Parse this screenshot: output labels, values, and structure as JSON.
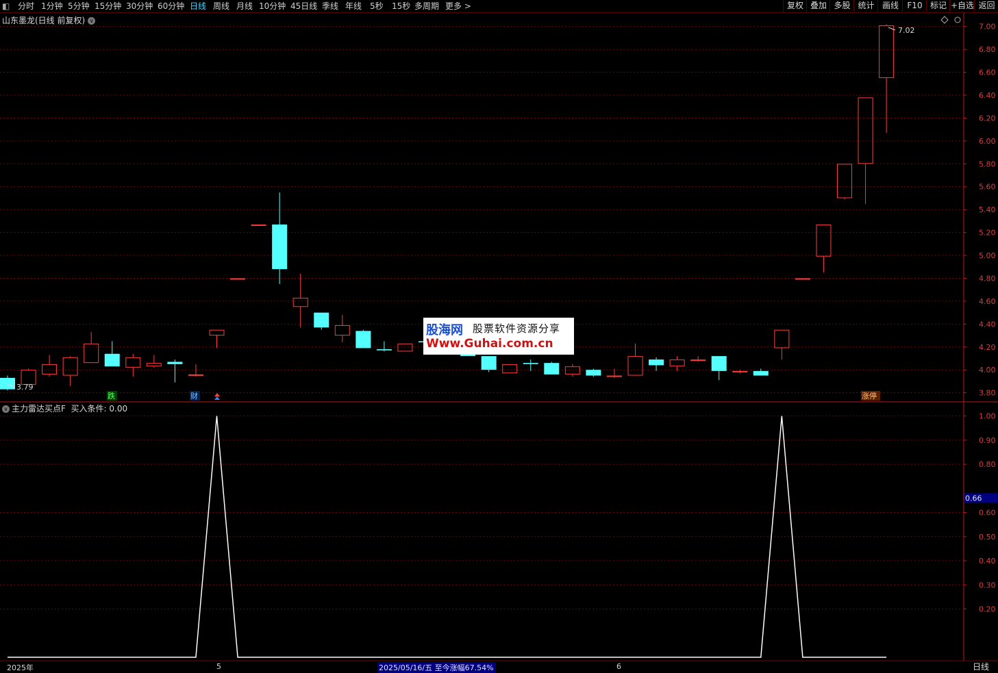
{
  "toolbar": {
    "periods": [
      "分时",
      "1分钟",
      "5分钟",
      "15分钟",
      "30分钟",
      "60分钟",
      "日线",
      "周线",
      "月线",
      "10分钟",
      "45日线",
      "季线",
      "年线",
      "5秒",
      "15秒",
      "多周期",
      "更多 >"
    ],
    "active_period": "日线",
    "right_buttons": [
      "复权",
      "叠加",
      "多股",
      "统计",
      "画线",
      "F10",
      "标记",
      "+自选",
      "返回"
    ]
  },
  "main_chart": {
    "title": "山东墨龙(日线 前复权)",
    "high_label": "7.02",
    "low_label": "3.79",
    "markers": [
      "跌",
      "财",
      "涨停"
    ],
    "y_ticks": [
      "7.00",
      "6.80",
      "6.60",
      "6.40",
      "6.20",
      "6.00",
      "5.80",
      "5.60",
      "5.40",
      "5.20",
      "5.00",
      "4.80",
      "4.60",
      "4.40",
      "4.20",
      "4.00",
      "3.80"
    ],
    "colors": {
      "up": "#ff3c3c",
      "down": "#54ffff",
      "grid": "#7a0000",
      "axis": "#c01818"
    }
  },
  "chart_data": [
    {
      "type": "candlestick",
      "title": "山东墨龙(日线 前复权)",
      "ylim": [
        3.72,
        7.1
      ],
      "candles": [
        {
          "o": 3.93,
          "h": 3.95,
          "l": 3.82,
          "c": 3.83
        },
        {
          "o": 3.87,
          "h": 4.01,
          "l": 3.87,
          "c": 4.0
        },
        {
          "o": 3.96,
          "h": 4.13,
          "l": 3.94,
          "c": 4.05
        },
        {
          "o": 3.95,
          "h": 4.12,
          "l": 3.86,
          "c": 4.11
        },
        {
          "o": 4.06,
          "h": 4.33,
          "l": 4.06,
          "c": 4.23
        },
        {
          "o": 4.14,
          "h": 4.25,
          "l": 4.03,
          "c": 4.03
        },
        {
          "o": 4.02,
          "h": 4.14,
          "l": 3.94,
          "c": 4.11
        },
        {
          "o": 4.03,
          "h": 4.13,
          "l": 4.02,
          "c": 4.06
        },
        {
          "o": 4.07,
          "h": 4.09,
          "l": 3.89,
          "c": 4.05
        },
        {
          "o": 3.96,
          "h": 4.05,
          "l": 3.94,
          "c": 3.96
        },
        {
          "o": 4.3,
          "h": 4.35,
          "l": 4.19,
          "c": 4.35
        },
        {
          "o": 4.8,
          "h": 4.8,
          "l": 4.8,
          "c": 4.8
        },
        {
          "o": 5.27,
          "h": 5.27,
          "l": 5.27,
          "c": 5.27
        },
        {
          "o": 5.27,
          "h": 5.55,
          "l": 4.75,
          "c": 4.88
        },
        {
          "o": 4.55,
          "h": 4.84,
          "l": 4.37,
          "c": 4.63
        },
        {
          "o": 4.5,
          "h": 4.5,
          "l": 4.35,
          "c": 4.37
        },
        {
          "o": 4.3,
          "h": 4.48,
          "l": 4.24,
          "c": 4.39
        },
        {
          "o": 4.34,
          "h": 4.35,
          "l": 4.2,
          "c": 4.19
        },
        {
          "o": 4.18,
          "h": 4.25,
          "l": 4.16,
          "c": 4.17
        },
        {
          "o": 4.16,
          "h": 4.23,
          "l": 4.16,
          "c": 4.23
        },
        {
          "o": 4.25,
          "h": 4.27,
          "l": 4.2,
          "c": 4.24
        },
        {
          "o": 4.27,
          "h": 4.3,
          "l": 4.22,
          "c": 4.24
        },
        {
          "o": 4.25,
          "h": 4.28,
          "l": 4.12,
          "c": 4.12
        },
        {
          "o": 4.12,
          "h": 4.12,
          "l": 3.98,
          "c": 4.0
        },
        {
          "o": 3.97,
          "h": 4.05,
          "l": 3.97,
          "c": 4.05
        },
        {
          "o": 4.06,
          "h": 4.09,
          "l": 3.99,
          "c": 4.05
        },
        {
          "o": 4.06,
          "h": 4.07,
          "l": 3.96,
          "c": 3.96
        },
        {
          "o": 3.96,
          "h": 4.05,
          "l": 3.94,
          "c": 4.03
        },
        {
          "o": 4.0,
          "h": 4.01,
          "l": 3.94,
          "c": 3.95
        },
        {
          "o": 3.94,
          "h": 4.01,
          "l": 3.93,
          "c": 3.95
        },
        {
          "o": 3.95,
          "h": 4.23,
          "l": 3.95,
          "c": 4.12
        },
        {
          "o": 4.09,
          "h": 4.11,
          "l": 3.99,
          "c": 4.04
        },
        {
          "o": 4.03,
          "h": 4.12,
          "l": 3.99,
          "c": 4.09
        },
        {
          "o": 4.08,
          "h": 4.12,
          "l": 4.07,
          "c": 4.09
        },
        {
          "o": 4.12,
          "h": 4.12,
          "l": 3.91,
          "c": 3.99
        },
        {
          "o": 3.98,
          "h": 4.0,
          "l": 3.97,
          "c": 3.99
        },
        {
          "o": 3.99,
          "h": 4.01,
          "l": 3.95,
          "c": 3.95
        },
        {
          "o": 4.19,
          "h": 4.35,
          "l": 4.09,
          "c": 4.35
        },
        {
          "o": 4.8,
          "h": 4.8,
          "l": 4.8,
          "c": 4.8
        },
        {
          "o": 4.99,
          "h": 5.27,
          "l": 4.85,
          "c": 5.27
        },
        {
          "o": 5.5,
          "h": 5.8,
          "l": 5.49,
          "c": 5.8
        },
        {
          "o": 5.8,
          "h": 6.38,
          "l": 5.45,
          "c": 6.38
        },
        {
          "o": 6.55,
          "h": 7.02,
          "l": 6.07,
          "c": 7.01
        }
      ]
    },
    {
      "type": "line",
      "title": "主力雷达买点F",
      "ylim": [
        0,
        1.05
      ],
      "series": [
        {
          "name": "买入条件",
          "values": [
            0,
            0,
            0,
            0,
            0,
            0,
            0,
            0,
            0,
            0,
            1,
            0,
            0,
            0,
            0,
            0,
            0,
            0,
            0,
            0,
            0,
            0,
            0,
            0,
            0,
            0,
            0,
            0,
            0,
            0,
            0,
            0,
            0,
            0,
            0,
            0,
            0,
            1,
            0,
            0,
            0,
            0,
            0
          ]
        }
      ]
    }
  ],
  "indicator": {
    "name": "主力雷达买点F",
    "param_label": "买入条件: 0.00",
    "y_ticks": [
      "1.00",
      "0.90",
      "0.80",
      "0.60",
      "0.50",
      "0.40",
      "0.30",
      "0.20"
    ],
    "current_value": "0.66",
    "line_color": "#ffffff"
  },
  "watermark": {
    "logo": "股海网",
    "subtitle": "股票软件资源分享",
    "url": "Www.Guhai.com.cn"
  },
  "status_bar": {
    "year": "2025年",
    "month1": "5",
    "cursor_info": "2025/05/16/五  至今涨幅67.54%",
    "month2": "6",
    "period_label": "日线"
  }
}
